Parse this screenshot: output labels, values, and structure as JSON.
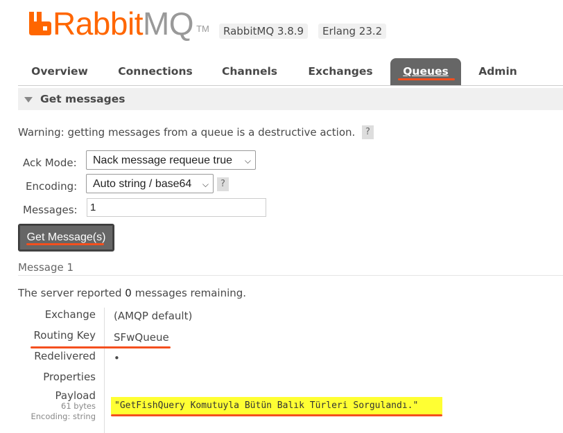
{
  "header": {
    "logo_rabbit": "Rabbit",
    "logo_mq": "MQ",
    "logo_tm": "TM",
    "version": "RabbitMQ 3.8.9",
    "erlang": "Erlang 23.2"
  },
  "tabs": [
    {
      "label": "Overview"
    },
    {
      "label": "Connections"
    },
    {
      "label": "Channels"
    },
    {
      "label": "Exchanges"
    },
    {
      "label": "Queues",
      "active": true
    },
    {
      "label": "Admin"
    }
  ],
  "section": {
    "title": "Get messages",
    "warning": "Warning: getting messages from a queue is a destructive action.",
    "help": "?"
  },
  "form": {
    "ack_mode_label": "Ack Mode:",
    "ack_mode_value": "Nack message requeue true",
    "encoding_label": "Encoding:",
    "encoding_value": "Auto string / base64",
    "messages_label": "Messages:",
    "messages_value": "1",
    "submit_label": "Get Message(s)"
  },
  "result": {
    "heading": "Message 1",
    "server_prefix": "The server reported ",
    "remaining_count": "0",
    "server_suffix": " messages remaining.",
    "exchange_label": "Exchange",
    "exchange_value": "(AMQP default)",
    "routing_key_label": "Routing Key",
    "routing_key_value": "SFwQueue",
    "redelivered_label": "Redelivered",
    "redelivered_value": "•",
    "properties_label": "Properties",
    "payload_label": "Payload",
    "payload_bytes": "61 bytes",
    "payload_encoding": "Encoding: string",
    "payload_value": "\"GetFishQuery Komutuyla Bütün Balık Türleri Sorgulandı.\""
  },
  "colors": {
    "brand_orange": "#ff6600",
    "annotation_red": "#f44f1e",
    "highlight_yellow": "#ffff33",
    "active_tab": "#666666"
  },
  "icons": {
    "logo": "rabbitmq-logo-icon",
    "collapse": "triangle-down-icon",
    "dropdown": "chevron-down-icon"
  }
}
